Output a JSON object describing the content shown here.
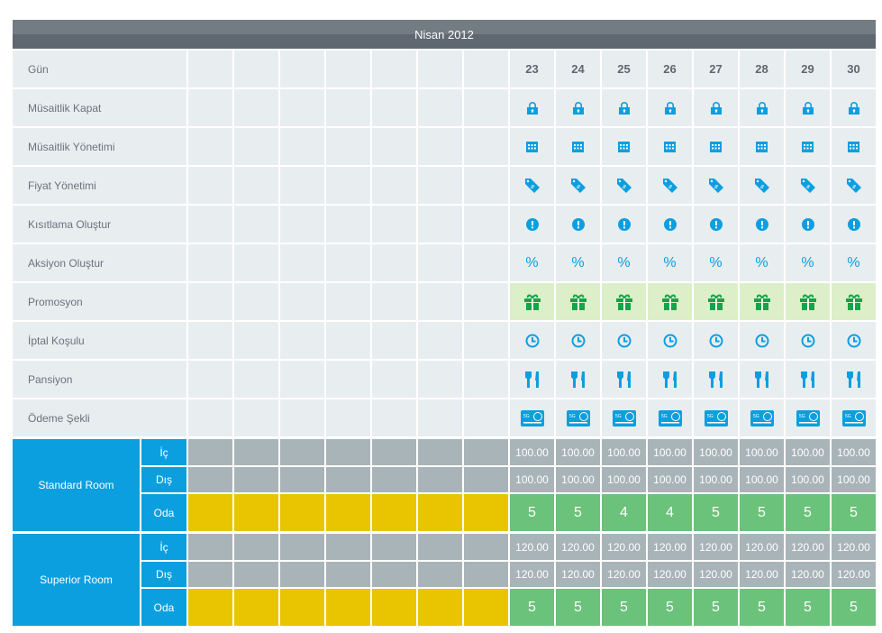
{
  "header": {
    "title": "Nisan 2012"
  },
  "days": [
    "23",
    "24",
    "25",
    "26",
    "27",
    "28",
    "29",
    "30"
  ],
  "rows": [
    {
      "label": "Gün",
      "type": "day"
    },
    {
      "label": "Müsaitlik Kapat",
      "type": "icon",
      "icon": "lock-icon"
    },
    {
      "label": "Müsaitlik Yönetimi",
      "type": "icon",
      "icon": "calendar-icon"
    },
    {
      "label": "Fiyat Yönetimi",
      "type": "icon",
      "icon": "price-tag-icon"
    },
    {
      "label": "Kısıtlama Oluştur",
      "type": "icon",
      "icon": "alert-icon"
    },
    {
      "label": "Aksiyon Oluştur",
      "type": "text",
      "text": "%"
    },
    {
      "label": "Promosyon",
      "type": "icon",
      "icon": "gift-icon"
    },
    {
      "label": "İptal Koşulu",
      "type": "icon",
      "icon": "clock-icon"
    },
    {
      "label": "Pansiyon",
      "type": "icon",
      "icon": "fork-knife-icon"
    },
    {
      "label": "Ödeme Şekli",
      "type": "icon",
      "icon": "credit-card-icon"
    }
  ],
  "rooms": [
    {
      "name": "Standard Room",
      "ic_label": "İç",
      "dis_label": "Dış",
      "oda_label": "Oda",
      "ic": [
        "100.00",
        "100.00",
        "100.00",
        "100.00",
        "100.00",
        "100.00",
        "100.00",
        "100.00"
      ],
      "dis": [
        "100.00",
        "100.00",
        "100.00",
        "100.00",
        "100.00",
        "100.00",
        "100.00",
        "100.00"
      ],
      "oda": [
        "5",
        "5",
        "4",
        "4",
        "5",
        "5",
        "5",
        "5"
      ]
    },
    {
      "name": "Superior Room",
      "ic_label": "İç",
      "dis_label": "Dış",
      "oda_label": "Oda",
      "ic": [
        "120.00",
        "120.00",
        "120.00",
        "120.00",
        "120.00",
        "120.00",
        "120.00",
        "120.00"
      ],
      "dis": [
        "120.00",
        "120.00",
        "120.00",
        "120.00",
        "120.00",
        "120.00",
        "120.00",
        "120.00"
      ],
      "oda": [
        "5",
        "5",
        "5",
        "5",
        "5",
        "5",
        "5",
        "5"
      ]
    }
  ],
  "colors": {
    "accent": "#0c9fdf",
    "promo": "#16a34a",
    "available": "#6bc27a",
    "closed": "#e8c500",
    "header": "#5f6870"
  }
}
